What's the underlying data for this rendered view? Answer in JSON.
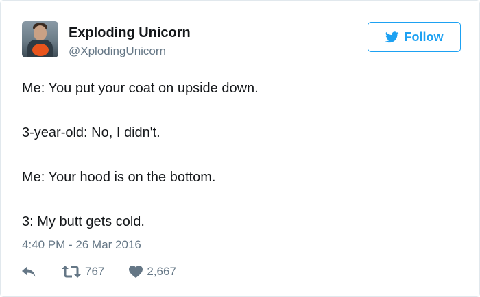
{
  "user": {
    "display_name": "Exploding Unicorn",
    "handle": "@XplodingUnicorn",
    "avatar_icon": "user-avatar"
  },
  "follow_button": {
    "label": "Follow",
    "icon": "twitter-bird-icon",
    "color": "#1da1f2"
  },
  "tweet": {
    "lines": [
      "Me: You put your coat on upside down.",
      "3-year-old: No, I didn't.",
      "Me: Your hood is on the bottom.",
      "3: My butt gets cold."
    ],
    "timestamp": "4:40 PM - 26 Mar 2016"
  },
  "actions": {
    "reply_icon": "reply-icon",
    "retweet_icon": "retweet-icon",
    "retweet_count": "767",
    "like_icon": "heart-icon",
    "like_count": "2,667"
  },
  "colors": {
    "text": "#14171a",
    "secondary": "#657786",
    "brand": "#1da1f2",
    "border": "#e1e8ed"
  }
}
